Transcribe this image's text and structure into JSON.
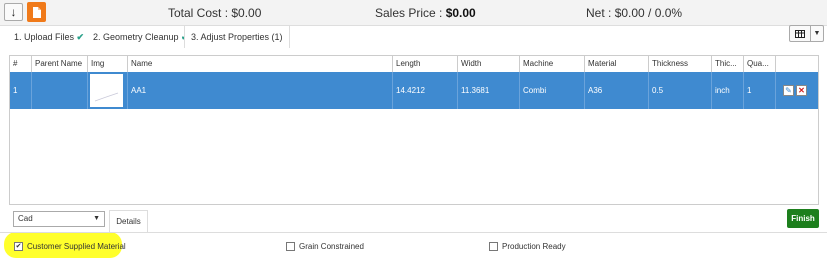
{
  "toolbar": {
    "download_icon": "down-arrow-icon",
    "file_icon": "document-icon",
    "colors": {
      "file_button": "#f07a1a"
    }
  },
  "summary": {
    "total_cost_label": "Total Cost :",
    "total_cost_value": "$0.00",
    "sales_price_label": "Sales Price :",
    "sales_price_value": "$0.00",
    "net_label": "Net :",
    "net_value": "$0.00 / 0.0%"
  },
  "tabs": [
    {
      "label": "1. Upload Files",
      "check": "✔"
    },
    {
      "label": "2. Geometry Cleanup",
      "check": "✔"
    },
    {
      "label": "3. Adjust Properties (1)",
      "check": ""
    }
  ],
  "grid": {
    "headers": [
      "#",
      "Parent Name",
      "Img",
      "Name",
      "Length",
      "Width",
      "Machine",
      "Material",
      "Thickness",
      "Thic...",
      "Qua..."
    ],
    "rows": [
      {
        "num": "1",
        "parent": "",
        "name": "AA1",
        "length": "14.4212",
        "width": "11.3681",
        "machine": "Combi",
        "material": "A36",
        "thickness": "0.5",
        "units": "inch",
        "qty": "1"
      }
    ],
    "colors": {
      "selected_row": "#3f8ad0"
    }
  },
  "footer": {
    "select_value": "Cad",
    "details_tab": "Details",
    "finish_button": "Finish",
    "options": [
      {
        "label": "Customer Supplied Material",
        "checked": true
      },
      {
        "label": "Grain Constrained",
        "checked": false
      },
      {
        "label": "Production Ready",
        "checked": false
      }
    ],
    "colors": {
      "finish": "#1d7f1d",
      "highlight": "#ffff1a"
    }
  }
}
